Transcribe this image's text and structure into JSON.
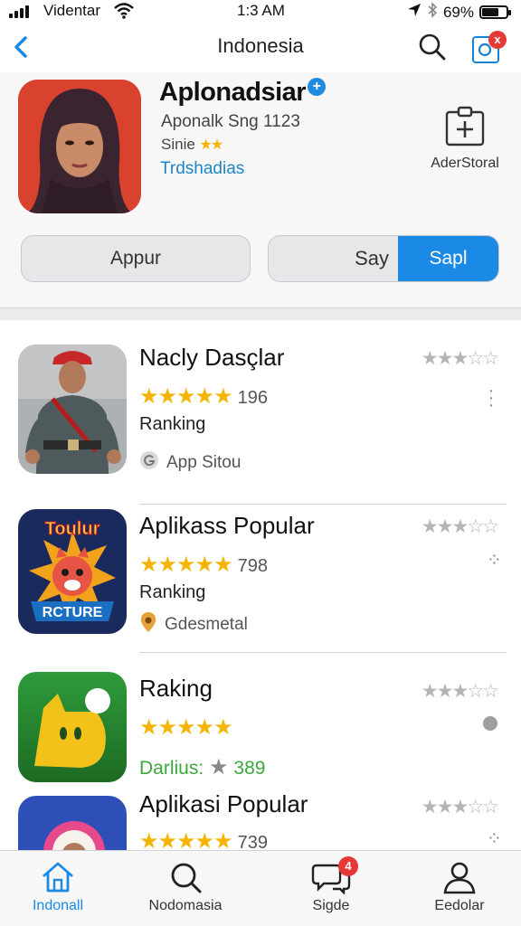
{
  "status_bar": {
    "carrier": "Videntar",
    "time": "1:3 AM",
    "battery": "69%",
    "battery_level": 0.69
  },
  "nav": {
    "title": "Indonesia",
    "back_icon": "chevron-left-icon",
    "search_icon": "search-icon",
    "notification_icon": "notification-icon",
    "notification_badge": "x"
  },
  "app": {
    "name": "Aplonadsiar",
    "subtitle": "Aponalk Sng 1123",
    "rating_label": "Sinie",
    "rating_stars": 2,
    "developer": "Trdshadias",
    "add_store_label": "AderStoral"
  },
  "actions": {
    "primary_button": "Appur",
    "segment_left": "Say",
    "segment_right": "Sapl"
  },
  "list": {
    "items": [
      {
        "name": "Nacly Dasçlar",
        "stars": 5,
        "count": "196",
        "rank_label": "Ranking",
        "source": "App Sitou",
        "outline_rating": 3.5
      },
      {
        "name": "Aplikass Popular",
        "stars": 5,
        "count": "798",
        "rank_label": "Ranking",
        "source": "Gdesmetal",
        "outline_rating": 3.5
      },
      {
        "name": "Raking",
        "stars": 4.5,
        "extra_label": "Darlius:",
        "extra_value": "389",
        "outline_rating": 3.5
      },
      {
        "name": "Aplikasi Popular",
        "stars": 4.5,
        "count": "739",
        "outline_rating": 3.5
      }
    ],
    "thumb2_text_top": "Toulur",
    "thumb2_text_bottom": "RCTURE"
  },
  "tabs": [
    {
      "label": "Indonall",
      "icon": "home-icon",
      "active": true
    },
    {
      "label": "Nodomasia",
      "icon": "search-icon",
      "active": false
    },
    {
      "label": "Sigde",
      "icon": "chat-bubbles-icon",
      "active": false,
      "badge": "4"
    },
    {
      "label": "Eedolar",
      "icon": "person-icon",
      "active": false
    }
  ],
  "colors": {
    "accent": "#1a8ae6",
    "star": "#f4b400",
    "badge": "#e53935",
    "developer_link": "#1c86c8",
    "green_text": "#3aa83a"
  }
}
